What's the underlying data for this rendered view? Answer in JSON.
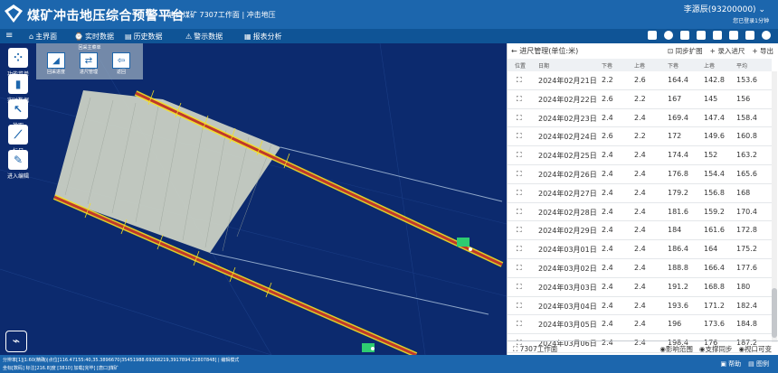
{
  "header": {
    "title": "煤矿冲击地压综合预警平台",
    "subtitle": "唐口煤矿 7307工作面 | 冲击地压",
    "user": "李源辰(93200000)",
    "user_sub": "您已登录1分钟"
  },
  "nav": {
    "items": [
      {
        "label": "主界面",
        "icon": "home-icon"
      },
      {
        "label": "实时数据",
        "icon": "realtime-icon"
      },
      {
        "label": "历史数据",
        "icon": "history-icon"
      },
      {
        "label": "警示数据",
        "icon": "warning-icon"
      },
      {
        "label": "报表分析",
        "icon": "report-icon"
      }
    ]
  },
  "map_tools": {
    "function_menu": "功能菜单",
    "realtime": "实时数据",
    "pickup": "拾取",
    "ruler": "标尺",
    "enter_edit": "进入编辑"
  },
  "subpanel": {
    "title": "回采主菜单",
    "buttons": [
      "回采进度",
      "进尺管理",
      "返回"
    ]
  },
  "panel": {
    "title": "进尺管理(单位:米)",
    "actions": [
      "同步扩图",
      "录入进尺",
      "导出"
    ],
    "columns": [
      "位置",
      "日期",
      "下巷",
      "上巷",
      "下巷",
      "上巷",
      "平均"
    ],
    "rows": [
      {
        "date": "2024年02月21日",
        "c1": "2.2",
        "c2": "2.6",
        "c3": "164.4",
        "c4": "142.8",
        "c5": "153.6"
      },
      {
        "date": "2024年02月22日",
        "c1": "2.6",
        "c2": "2.2",
        "c3": "167",
        "c4": "145",
        "c5": "156"
      },
      {
        "date": "2024年02月23日",
        "c1": "2.4",
        "c2": "2.4",
        "c3": "169.4",
        "c4": "147.4",
        "c5": "158.4"
      },
      {
        "date": "2024年02月24日",
        "c1": "2.6",
        "c2": "2.2",
        "c3": "172",
        "c4": "149.6",
        "c5": "160.8"
      },
      {
        "date": "2024年02月25日",
        "c1": "2.4",
        "c2": "2.4",
        "c3": "174.4",
        "c4": "152",
        "c5": "163.2"
      },
      {
        "date": "2024年02月26日",
        "c1": "2.4",
        "c2": "2.4",
        "c3": "176.8",
        "c4": "154.4",
        "c5": "165.6"
      },
      {
        "date": "2024年02月27日",
        "c1": "2.4",
        "c2": "2.4",
        "c3": "179.2",
        "c4": "156.8",
        "c5": "168"
      },
      {
        "date": "2024年02月28日",
        "c1": "2.4",
        "c2": "2.4",
        "c3": "181.6",
        "c4": "159.2",
        "c5": "170.4"
      },
      {
        "date": "2024年02月29日",
        "c1": "2.4",
        "c2": "2.4",
        "c3": "184",
        "c4": "161.6",
        "c5": "172.8"
      },
      {
        "date": "2024年03月01日",
        "c1": "2.4",
        "c2": "2.4",
        "c3": "186.4",
        "c4": "164",
        "c5": "175.2"
      },
      {
        "date": "2024年03月02日",
        "c1": "2.4",
        "c2": "2.4",
        "c3": "188.8",
        "c4": "166.4",
        "c5": "177.6"
      },
      {
        "date": "2024年03月03日",
        "c1": "2.4",
        "c2": "2.4",
        "c3": "191.2",
        "c4": "168.8",
        "c5": "180"
      },
      {
        "date": "2024年03月04日",
        "c1": "2.4",
        "c2": "2.4",
        "c3": "193.6",
        "c4": "171.2",
        "c5": "182.4"
      },
      {
        "date": "2024年03月05日",
        "c1": "2.4",
        "c2": "2.4",
        "c3": "196",
        "c4": "173.6",
        "c5": "184.8"
      },
      {
        "date": "2024年03月06日",
        "c1": "2.4",
        "c2": "2.4",
        "c3": "198.4",
        "c4": "176",
        "c5": "187.2"
      }
    ],
    "footer_left": "7307工作面",
    "footer_right": [
      "影响范围",
      "支撑同步",
      "视口可变"
    ]
  },
  "status": {
    "line1": "分辨率[1]|1:60(精确)|点位[116.47155:40,35.3896670|35451988.69268219,3917894.22807848] | 编辑模式",
    "line2": "坐标[数码] 标注[216.8]度 [3810] 加载[完毕] [唐口]煤矿",
    "right": [
      "帮助",
      "图例"
    ]
  },
  "colors": {
    "header": "#1c66ad",
    "nav": "#0f5496",
    "map_bg": "#0c2a6e",
    "roadway": "#c0392b",
    "support": "#f5e020",
    "goaf": "#d4d8c8"
  }
}
